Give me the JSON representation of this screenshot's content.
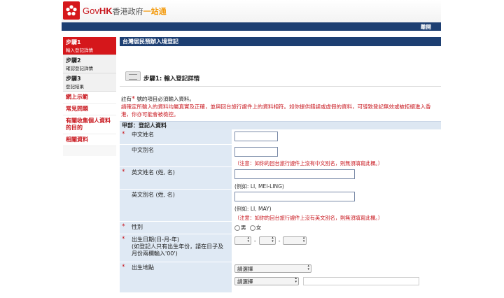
{
  "header": {
    "brand_gov": "Gov",
    "brand_hk": "HK",
    "brand_cn": "香港政府",
    "brand_one": "一站通",
    "logout": "離開"
  },
  "nav": {
    "steps": [
      {
        "title": "步驟1",
        "sub": "輸入登記詳情"
      },
      {
        "title": "步驟2",
        "sub": "確認登記詳情"
      },
      {
        "title": "步驟3",
        "sub": "登記結果"
      }
    ],
    "links": [
      "網上示範",
      "常見問題",
      "有關收集個人資料的目的",
      "相關資料"
    ]
  },
  "main": {
    "title": "台灣居民預辦入境登記",
    "step_title": "步驟1: 輸入登記詳情",
    "note_pre": "註有",
    "note_star": "*",
    "note_post": " 號的項目必須輸入資料。",
    "note_red": "請確定所輸入的資料均屬真實及正確，並與回台旅行證件上的資料相符。如你提供錯誤或虛假的資料，可導致登記無效或被拒絕進入香港，你亦可能會被檢控。",
    "section": "甲部：登記人資料",
    "fields": {
      "cn_name": "中文姓名",
      "cn_alias": "中文別名",
      "cn_alias_hint": "（注意：如你的回台旅行證件上沒有中文別名，則無須填寫此欄。）",
      "en_name": "英文姓名 (姓, 名)",
      "en_name_example": "(例如: LI, MEI-LING)",
      "en_alias": "英文別名 (姓, 名)",
      "en_alias_example": "(例如: LI, MAY)",
      "en_alias_hint": "（注意：如你的回台旅行證件上沒有英文別名，則無須填寫此欄。）",
      "sex": "性別",
      "male": "男",
      "female": "女",
      "dob_line1": "出生日期(日-月-年)",
      "dob_line2": "(如登記人只有出生年份，請在日子及月份兩欄輸入'00')",
      "pob": "出生地點",
      "pob_select1": "請選擇",
      "pob_select2": "請選擇"
    }
  }
}
